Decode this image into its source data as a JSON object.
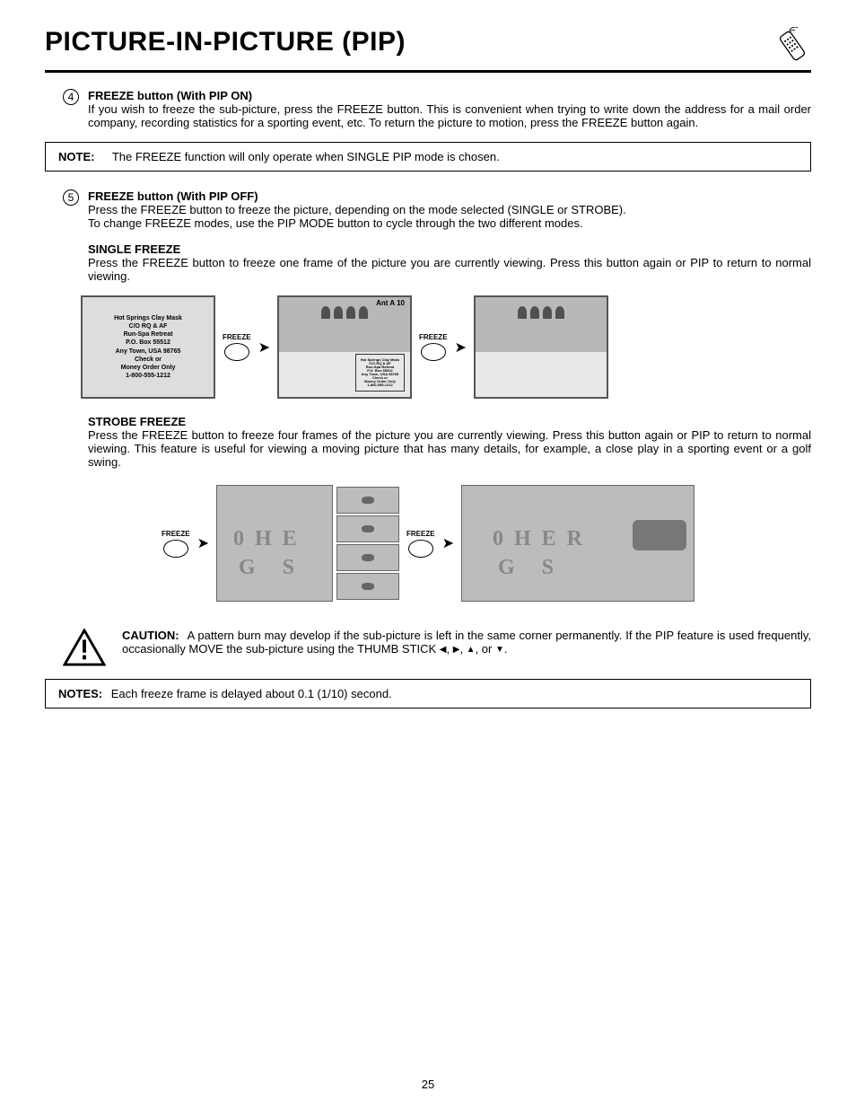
{
  "page": {
    "title": "PICTURE-IN-PICTURE (PIP)",
    "number": "25"
  },
  "step4": {
    "num": "4",
    "title": "FREEZE button (With PIP ON)",
    "body": "If you wish to freeze the sub-picture, press the FREEZE button. This is convenient when trying to write down the address for a mail order company, recording statistics for a sporting event, etc.  To return the picture to motion, press the FREEZE button again."
  },
  "note1": {
    "label": "NOTE:",
    "text": "The FREEZE function will only operate when SINGLE PIP mode is chosen."
  },
  "step5": {
    "num": "5",
    "title": "FREEZE button (With PIP OFF)",
    "line1": "Press the FREEZE button to freeze the picture, depending on the mode selected (SINGLE or STROBE).",
    "line2": "To change FREEZE modes, use the PIP MODE button to cycle through the two different modes."
  },
  "single": {
    "heading": "SINGLE FREEZE",
    "text": "Press the FREEZE button to freeze one frame of the picture you are currently viewing.  Press this button again or PIP to return to normal viewing."
  },
  "tvtext": {
    "l1": "Hot Springs Clay Mask",
    "l2": "C/O RQ & AF",
    "l3": "Run-Spa Retreat",
    "l4": "P.O. Box 55512",
    "l5": "Any Town, USA 98765",
    "l6": "Check or",
    "l7": "Money Order Only",
    "l8": "1-800-555-1212"
  },
  "ant": "Ant A 10",
  "freeze_label": "FREEZE",
  "strobe": {
    "heading": "STROBE FREEZE",
    "text": "Press the FREEZE button to freeze four frames of the picture you are currently viewing. Press this button again or PIP to return to normal viewing. This feature is useful for viewing a moving picture that has many details, for example, a close play in a sporting event or a golf swing."
  },
  "caution": {
    "label": "CAUTION:",
    "text_a": "A pattern burn may develop if the sub-picture is left in the same corner permanently.  If the PIP feature is used frequently, occasionally MOVE the sub-picture using the THUMB STICK ",
    "text_b": "."
  },
  "notes2": {
    "label": "NOTES:",
    "text": "Each freeze frame is delayed about 0.1 (1/10) second."
  }
}
